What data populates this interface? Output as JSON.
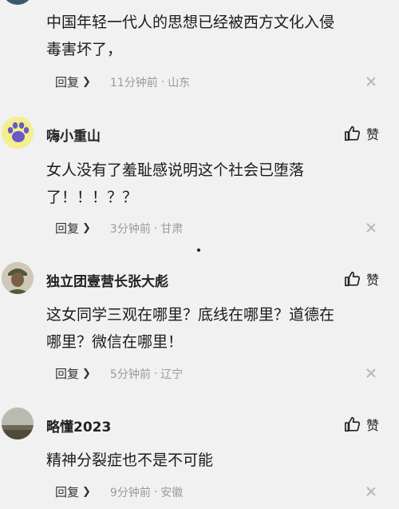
{
  "comments": [
    {
      "username": "",
      "text_lines": [
        "中国年轻一代人的思想已经被西方文化入侵",
        "毒害坏了，"
      ],
      "reply": "回复",
      "time": "11分钟前",
      "location": "山东"
    },
    {
      "username": "嗨小重山",
      "text_lines": [
        "女人没有了羞耻感说明这个社会已堕落",
        "了！！！？？"
      ],
      "reply": "回复",
      "time": "3分钟前",
      "location": "甘肃",
      "like": "赞"
    },
    {
      "username": "独立团壹营长张大彪",
      "text_lines": [
        "这女同学三观在哪里？底线在哪里？道德在",
        "哪里？微信在哪里！"
      ],
      "reply": "回复",
      "time": "5分钟前",
      "location": "辽宁",
      "like": "赞"
    },
    {
      "username": "略懂2023",
      "text_lines": [
        "精神分裂症也不是不可能"
      ],
      "reply": "回复",
      "time": "9分钟前",
      "location": "安徽",
      "like": "赞"
    }
  ],
  "separator": "·",
  "colors": {
    "background": "#f1f1f1",
    "meta_gray": "#9a9a9a",
    "text": "#1b1b1b"
  },
  "icons": {
    "like": "thumbs-up-icon",
    "reply_arrow": "chevron-right-icon",
    "dismiss": "close-icon"
  }
}
